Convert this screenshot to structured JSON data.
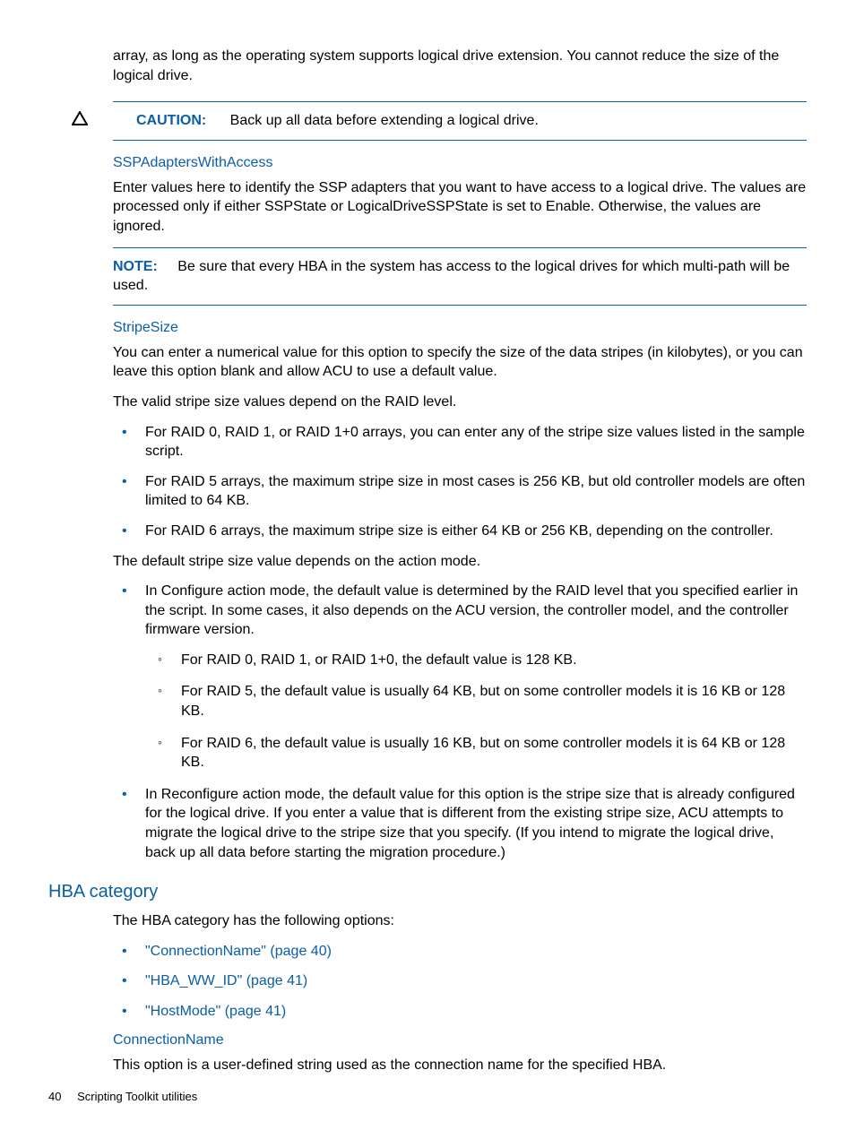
{
  "intro": "array, as long as the operating system supports logical drive extension. You cannot reduce the size of the logical drive.",
  "caution": {
    "label": "CAUTION:",
    "text": "Back up all data before extending a logical drive."
  },
  "ssp": {
    "heading": "SSPAdaptersWithAccess",
    "para": "Enter values here to identify the SSP adapters that you want to have access to a logical drive. The values are processed only if either SSPState or LogicalDriveSSPState is set to Enable. Otherwise, the values are ignored."
  },
  "note": {
    "label": "NOTE:",
    "text": "Be sure that every HBA in the system has access to the logical drives for which multi-path will be used."
  },
  "stripe": {
    "heading": "StripeSize",
    "para1": "You can enter a numerical value for this option to specify the size of the data stripes (in kilobytes), or you can leave this option blank and allow ACU to use a default value.",
    "para2": "The valid stripe size values depend on the RAID level.",
    "bullets1": [
      "For RAID 0, RAID 1, or RAID 1+0 arrays, you can enter any of the stripe size values listed in the sample script.",
      "For RAID 5 arrays, the maximum stripe size in most cases is 256 KB, but old controller models are often limited to 64 KB.",
      "For RAID 6 arrays, the maximum stripe size is either 64 KB or 256 KB, depending on the controller."
    ],
    "para3": "The default stripe size value depends on the action mode.",
    "bullets2": [
      {
        "text": "In Configure action mode, the default value is determined by the RAID level that you specified earlier in the script. In some cases, it also depends on the ACU version, the controller model, and the controller firmware version.",
        "sub": [
          "For RAID 0, RAID 1, or RAID 1+0, the default value is 128 KB.",
          "For RAID 5, the default value is usually 64 KB, but on some controller models it is 16 KB or 128 KB.",
          "For RAID 6, the default value is usually 16 KB, but on some controller models it is 64 KB or 128 KB."
        ]
      },
      {
        "text": "In Reconfigure action mode, the default value for this option is the stripe size that is already configured for the logical drive. If you enter a value that is different from the existing stripe size, ACU attempts to migrate the logical drive to the stripe size that you specify. (If you intend to migrate the logical drive, back up all data before starting the migration procedure.)"
      }
    ]
  },
  "hba": {
    "heading": "HBA category",
    "intro": "The HBA category has the following options:",
    "links": [
      "\"ConnectionName\" (page 40)",
      "\"HBA_WW_ID\" (page 41)",
      "\"HostMode\" (page 41)"
    ],
    "conn": {
      "heading": "ConnectionName",
      "para": "This option is a user-defined string used as the connection name for the specified HBA."
    }
  },
  "footer": {
    "page": "40",
    "title": "Scripting Toolkit utilities"
  }
}
